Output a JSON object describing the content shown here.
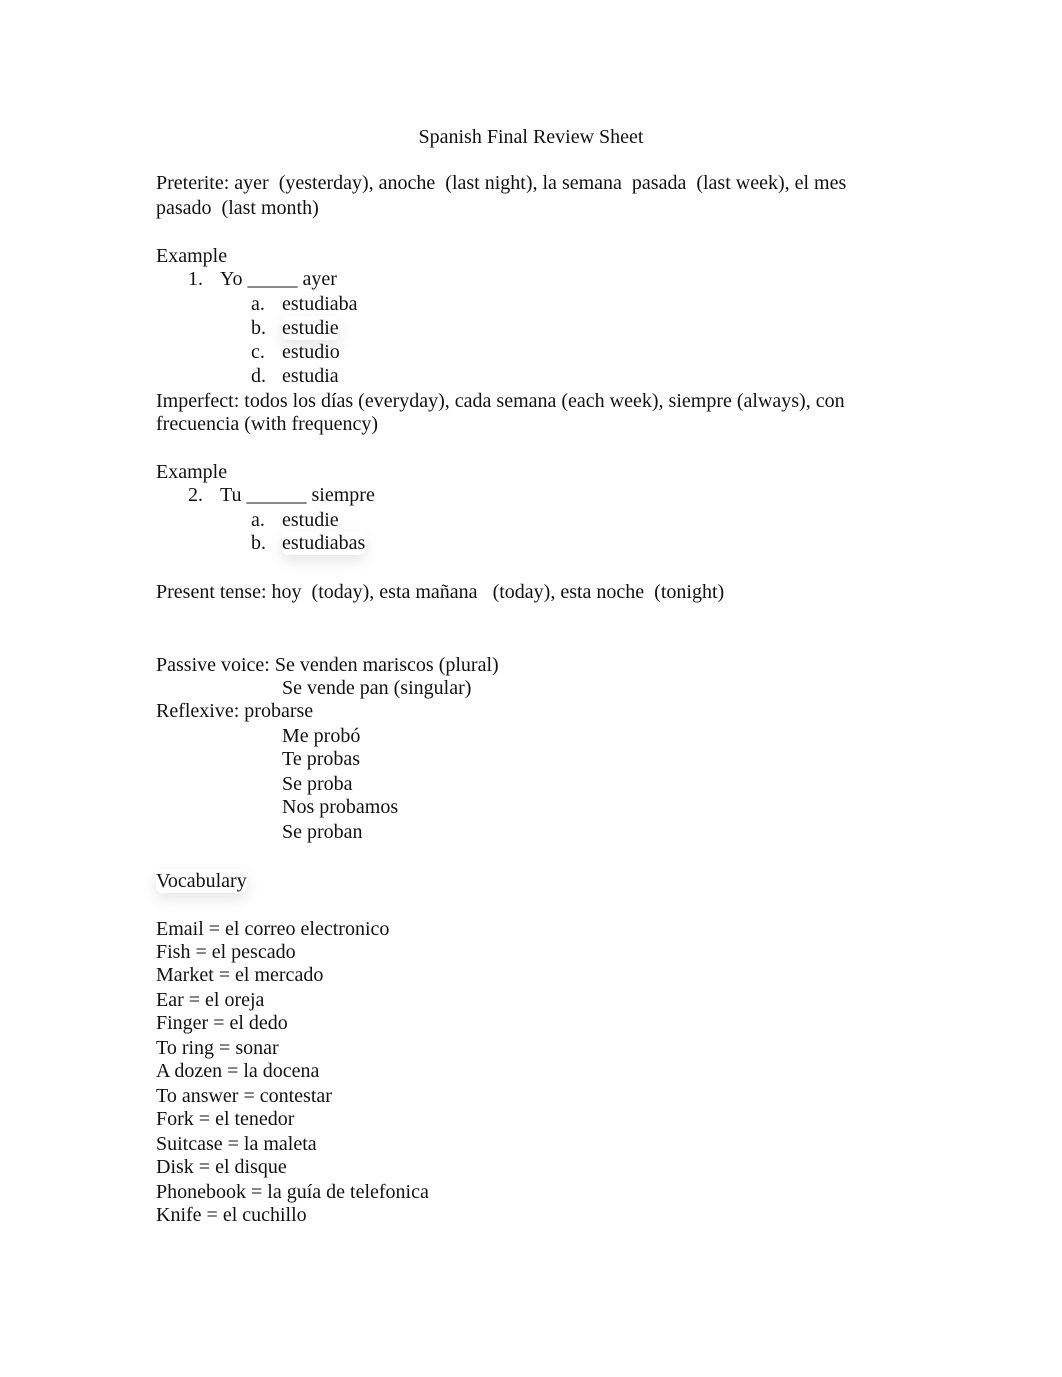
{
  "document": {
    "title": "Spanish Final Review Sheet",
    "preterite": {
      "line1": "Preterite: ayer  (yesterday), anoche  (last night), la semana  pasada  (last week), el mes",
      "line2": "pasado  (last month)"
    },
    "example1": {
      "heading": "Example",
      "number": "1.",
      "prompt": "Yo _____ ayer",
      "options": [
        {
          "letter": "a.",
          "text": "estudiaba"
        },
        {
          "letter": "b.",
          "text": "estudie"
        },
        {
          "letter": "c.",
          "text": "estudio"
        },
        {
          "letter": "d.",
          "text": "estudia"
        }
      ]
    },
    "imperfect": {
      "line1": "Imperfect: todos los días (everyday), cada semana (each week), siempre (always), con",
      "line2": "frecuencia (with frequency)"
    },
    "example2": {
      "heading": "Example",
      "number": "2.",
      "prompt": "Tu ______ siempre",
      "options": [
        {
          "letter": "a.",
          "text": "estudie"
        },
        {
          "letter": "b.",
          "text": "estudiabas"
        }
      ]
    },
    "present": "Present tense: hoy  (today), esta mañana   (today), esta noche  (tonight)",
    "passive": {
      "label": "Passive voice: Se venden mariscos (plural)",
      "line2": "Se vende pan (singular)"
    },
    "reflexive": {
      "label": "Reflexive: probarse",
      "forms": [
        "Me probó",
        "Te probas",
        "Se proba",
        "Nos probamos",
        "Se proban"
      ]
    },
    "vocabulary": {
      "heading": "Vocabulary",
      "items": [
        "Email = el correo electronico",
        "Fish = el pescado",
        "Market = el mercado",
        "Ear = el oreja",
        "Finger = el dedo",
        "To ring = sonar",
        "A dozen = la docena",
        "To answer = contestar",
        "Fork = el tenedor",
        "Suitcase = la maleta",
        "Disk = el disque",
        "Phonebook = la guía de telefonica",
        "Knife = el cuchillo"
      ]
    }
  }
}
